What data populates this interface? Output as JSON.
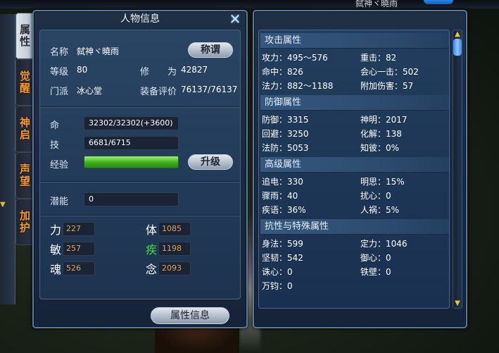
{
  "top_bar": {
    "label": "弑神ヾ曉雨"
  },
  "side_tabs": [
    "属性",
    "觉醒",
    "神启",
    "声望",
    "加护"
  ],
  "char_panel": {
    "title": "人物信息",
    "name_label": "名称",
    "name_value": "弑神ヾ曉雨",
    "title_button": "称谓",
    "level_label": "等级",
    "level_value": "80",
    "cultivation_label": "修　　为",
    "cultivation_value": "42827",
    "faction_label": "门派",
    "faction_value": "冰心堂",
    "gear_label": "装备评价",
    "gear_value": "76137/76137",
    "hp_label": "命",
    "hp_value": "32302/32302(+3600)",
    "mp_label": "技",
    "mp_value": "6681/6715",
    "exp_label": "经验",
    "exp_progress": 1.0,
    "upgrade_button": "升级",
    "potential_label": "潜能",
    "potential_value": "0",
    "stats": [
      {
        "label": "力",
        "value": "227"
      },
      {
        "label": "体",
        "value": "1085"
      },
      {
        "label": "敏",
        "value": "257"
      },
      {
        "label": "疾",
        "value": "1198"
      },
      {
        "label": "魂",
        "value": "526"
      },
      {
        "label": "念",
        "value": "2093"
      }
    ],
    "bottom_button": "属性信息"
  },
  "attr_panel": {
    "sections": [
      {
        "header": "攻击属性",
        "rows": [
          [
            "攻力：495～576",
            "重击：82"
          ],
          [
            "命中：826",
            "会心一击：502"
          ],
          [
            "法力：882～1188",
            "附加伤害：57"
          ]
        ]
      },
      {
        "header": "防御属性",
        "rows": [
          [
            "防御：3315",
            "神明：2017"
          ],
          [
            "回避：3250",
            "化解：138"
          ],
          [
            "法防：5053",
            "知彼：0%"
          ]
        ]
      },
      {
        "header": "高级属性",
        "rows": [
          [
            "追电：330",
            "明思：15%"
          ],
          [
            "骤雨：40",
            "扰心：0"
          ],
          [
            "疾语：36%",
            "人祸：5%"
          ]
        ]
      },
      {
        "header": "抗性与特殊属性",
        "rows": [
          [
            "身法：599",
            "定力：1046"
          ],
          [
            "坚韧：542",
            "御心：0"
          ],
          [
            "诛心：0",
            "铁壁：0"
          ],
          [
            "万钧：0",
            ""
          ]
        ]
      }
    ]
  },
  "colors": {
    "accent_orange": "#ff9a28",
    "panel_border": "#5c7898",
    "stat_value": "#e0a25c",
    "green_stat": "#3fdc3f",
    "exp_fill": "#3fae1d"
  },
  "icons": {
    "close": "close-icon",
    "scroll_up": "triangle-up-icon",
    "scroll_down": "triangle-down-icon"
  }
}
